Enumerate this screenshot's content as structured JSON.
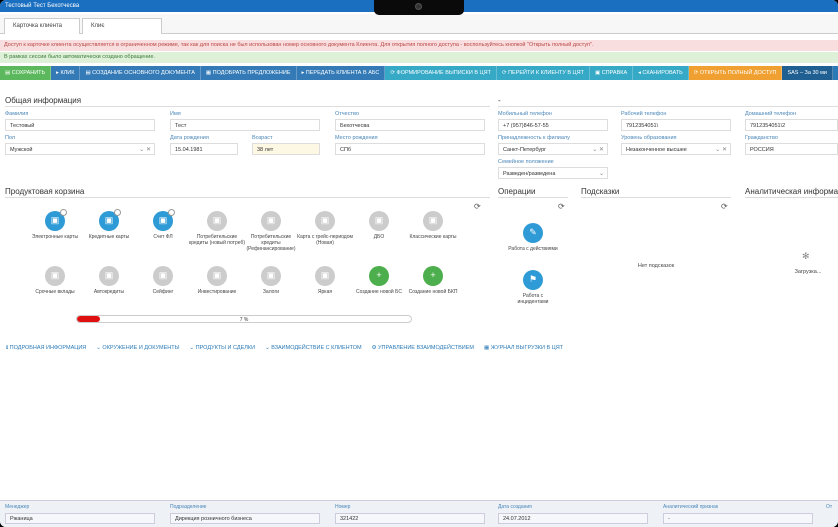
{
  "window": {
    "title": "Тестовый Тест Бехотчесва"
  },
  "tabs": [
    {
      "label": "Карточка клиента"
    },
    {
      "label": "Клиє"
    }
  ],
  "alerts": {
    "restricted": "Доступ к карточке клиента осуществляется в ограниченном режиме, так как для поиска не был использован номер основного документа Клиента. Для открытия полного доступа - воспользуйтесь кнопкой \"Открыть полный доступ\".",
    "auto_created": "В рамках сессии было автоматически создано обращение."
  },
  "toolbar": [
    {
      "label": "СОХРАНИТЬ",
      "style": "green"
    },
    {
      "label": "КЛИК",
      "style": "blue"
    },
    {
      "label": "СОЗДАНИЕ ОСНОВНОГО ДОКУМЕНТА",
      "style": "blue"
    },
    {
      "label": "ПОДОБРАТЬ ПРЕДЛОЖЕНИЕ",
      "style": "blue"
    },
    {
      "label": "ПЕРЕДАТЬ КЛИЕНТА В АБС",
      "style": "blue"
    },
    {
      "label": "ФОРМИРОВАНИЕ ВЫПИСКИ В ЦЯТ",
      "style": "teal"
    },
    {
      "label": "ПЕРЕЙТИ К КЛИЕНТУ В ЦЯТ",
      "style": "teal"
    },
    {
      "label": "СПРАВКА",
      "style": "teal"
    },
    {
      "label": "СКАНИРОВАТЬ",
      "style": "teal"
    },
    {
      "label": "ОТКРЫТЬ ПОЛНЫЙ ДОСТУП",
      "style": "orange"
    },
    {
      "label": "SAS – За 30 ми",
      "style": "dark"
    }
  ],
  "general": {
    "title": "Общая информация",
    "surname": {
      "label": "Фамилия",
      "value": "Тестовый"
    },
    "name": {
      "label": "Имя",
      "value": "Тест"
    },
    "patronymic": {
      "label": "Отчество",
      "value": "Бехотчесва"
    },
    "gender": {
      "label": "Пол",
      "value": "Мужской"
    },
    "birth_date": {
      "label": "Дата рождения",
      "value": "15.04.1981"
    },
    "age": {
      "label": "Возраст",
      "value": "38 лет"
    },
    "birth_place": {
      "label": "Место рождения",
      "value": "СПб"
    }
  },
  "contacts": {
    "title": "-",
    "mobile": {
      "label": "Мобильный телефон",
      "value": "+7 (957)846-57-55"
    },
    "work": {
      "label": "Рабочий телефон",
      "value": "7912354051\\"
    },
    "home": {
      "label": "Домашний телефон",
      "value": "7912354051\\2"
    },
    "branch": {
      "label": "Принадлежность к филиалу",
      "value": "Санкт-Петербург"
    },
    "education": {
      "label": "Уровень образования",
      "value": "Незаконченное высшее"
    },
    "citizenship": {
      "label": "Гражданство",
      "value": "РОССИЯ"
    },
    "marital": {
      "label": "Семейное положение",
      "value": "Разведен/разведена"
    }
  },
  "basket": {
    "title": "Продуктовая корзина",
    "products": [
      {
        "name": "Электронные карты",
        "state": "on",
        "icon": "card-icon"
      },
      {
        "name": "Кредитные карты",
        "state": "on",
        "icon": "credit-card-icon"
      },
      {
        "name": "Счет ФЛ",
        "state": "on",
        "icon": "account-icon"
      },
      {
        "name": "Потребительские кредиты (новый потреб)",
        "state": "off",
        "icon": "loan-icon"
      },
      {
        "name": "Потребительские кредиты (Рефинансирование)",
        "state": "off",
        "icon": "loan-icon"
      },
      {
        "name": "Карта с грейс-периодом (Новая)",
        "state": "off",
        "icon": "grace-card-icon"
      },
      {
        "name": "ДБО",
        "state": "off",
        "icon": "remote-banking-icon"
      },
      {
        "name": "Классические карты",
        "state": "off",
        "icon": "classic-card-icon"
      },
      {
        "name": "Срочные вклады",
        "state": "off",
        "icon": "deposit-icon"
      },
      {
        "name": "Автокредиты",
        "state": "off",
        "icon": "car-icon"
      },
      {
        "name": "Сейфинг",
        "state": "off",
        "icon": "safe-icon"
      },
      {
        "name": "Инвестирование",
        "state": "off",
        "icon": "invest-icon"
      },
      {
        "name": "Залоги",
        "state": "off",
        "icon": "pledge-icon"
      },
      {
        "name": "Яркая",
        "state": "off",
        "icon": "bright-icon"
      },
      {
        "name": "Создание новой БС",
        "state": "add",
        "icon": "plus-icon"
      },
      {
        "name": "Создание новой БКП",
        "state": "add",
        "icon": "plus-icon"
      }
    ],
    "progress_label": "7 %",
    "progress_value": 7
  },
  "links": [
    "ПОДРОБНАЯ ИНФОРМАЦИЯ",
    "ОКРУЖЕНИЕ И ДОКУМЕНТЫ",
    "ПРОДУКТЫ И СДЕЛКИ",
    "ВЗАИМОДЕЙСТВИЕ С КЛИЕНТОМ",
    "УПРАВЛЕНИЕ ВЗАИМОДЕЙСТВИЕМ",
    "ЖУРНАЛ ВЫГРУЗКИ В ЦЯТ"
  ],
  "operations": {
    "title": "Операции",
    "items": [
      {
        "name": "Работа с действиями"
      },
      {
        "name": "Работа с инцидентами"
      }
    ]
  },
  "hints": {
    "title": "Подсказки",
    "empty": "Нет подсказок"
  },
  "analytics": {
    "title": "Аналитическая информация",
    "loading": "Загрузка..."
  },
  "footer": [
    {
      "label": "Менеджер",
      "value": "Ржаница"
    },
    {
      "label": "Подразделение",
      "value": "Дирекция розничного бизнеса"
    },
    {
      "label": "Номер",
      "value": "321422"
    },
    {
      "label": "Дата создания",
      "value": "24.07.2012"
    },
    {
      "label": "Аналитический признак",
      "value": "-"
    },
    {
      "label": "От",
      "value": ""
    }
  ]
}
